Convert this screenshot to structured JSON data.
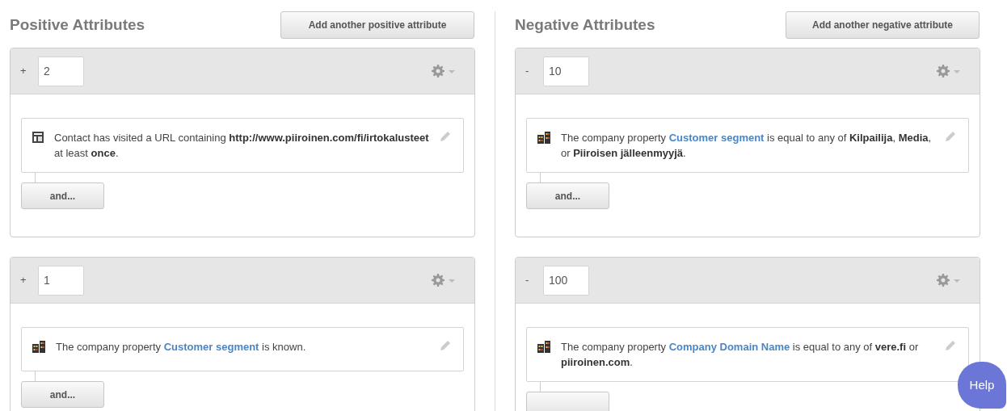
{
  "columns": [
    {
      "title": "Positive Attributes",
      "add_button": "Add another positive attribute",
      "groups": [
        {
          "sign": "+",
          "score": "2",
          "conditions": [
            {
              "kind": "page",
              "parts": [
                {
                  "kind": "text",
                  "text": "Contact has visited a URL containing "
                },
                {
                  "kind": "bold",
                  "text": "http://www.piiroinen.com/fi/irtokalusteet"
                },
                {
                  "kind": "text",
                  "text": " at least "
                },
                {
                  "kind": "bold",
                  "text": "once"
                },
                {
                  "kind": "text",
                  "text": "."
                }
              ]
            }
          ],
          "and_button": "and..."
        },
        {
          "sign": "+",
          "score": "1",
          "conditions": [
            {
              "kind": "company",
              "parts": [
                {
                  "kind": "text",
                  "text": "The company property "
                },
                {
                  "kind": "link",
                  "text": "Customer segment"
                },
                {
                  "kind": "text",
                  "text": " is known."
                }
              ]
            }
          ],
          "and_button": "and..."
        }
      ]
    },
    {
      "title": "Negative Attributes",
      "add_button": "Add another negative attribute",
      "groups": [
        {
          "sign": "-",
          "score": "10",
          "conditions": [
            {
              "kind": "company",
              "parts": [
                {
                  "kind": "text",
                  "text": "The company property "
                },
                {
                  "kind": "link",
                  "text": "Customer segment"
                },
                {
                  "kind": "text",
                  "text": " is equal to any of "
                },
                {
                  "kind": "bold",
                  "text": "Kilpailija"
                },
                {
                  "kind": "text",
                  "text": ", "
                },
                {
                  "kind": "bold",
                  "text": "Media"
                },
                {
                  "kind": "text",
                  "text": ", or "
                },
                {
                  "kind": "bold",
                  "text": "Piiroisen jälleenmyyjä"
                },
                {
                  "kind": "text",
                  "text": "."
                }
              ]
            }
          ],
          "and_button": "and..."
        },
        {
          "sign": "-",
          "score": "100",
          "conditions": [
            {
              "kind": "company",
              "parts": [
                {
                  "kind": "text",
                  "text": "The company property "
                },
                {
                  "kind": "link",
                  "text": "Company Domain Name"
                },
                {
                  "kind": "text",
                  "text": " is equal to any of "
                },
                {
                  "kind": "bold",
                  "text": "vere.fi"
                },
                {
                  "kind": "text",
                  "text": " or "
                },
                {
                  "kind": "bold",
                  "text": "piiroinen.com"
                },
                {
                  "kind": "text",
                  "text": "."
                }
              ]
            }
          ]
        }
      ]
    }
  ],
  "help_button": "Help"
}
